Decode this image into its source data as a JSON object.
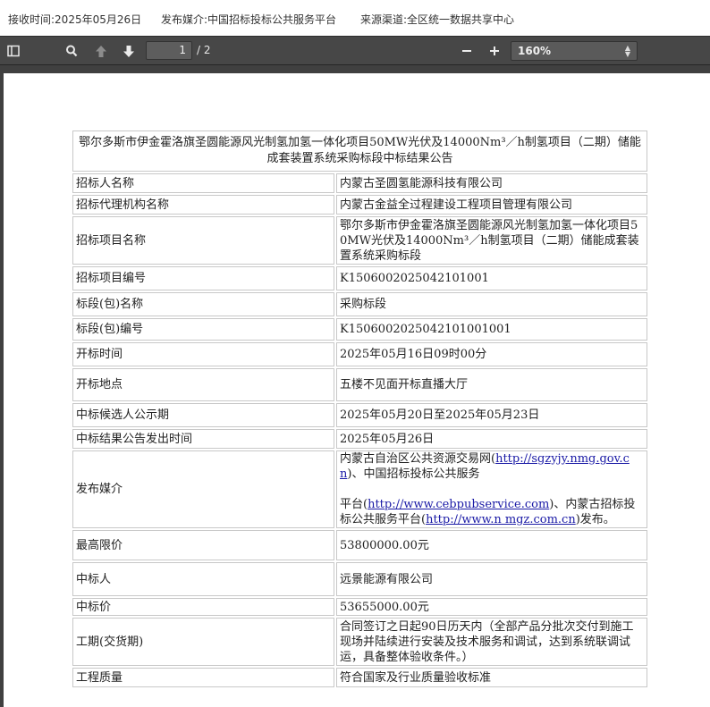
{
  "header": {
    "received": "接收时间:2025年05月26日",
    "media": "发布媒介:中国招标投标公共服务平台",
    "source": "来源渠道:全区统一数据共享中心"
  },
  "toolbar": {
    "page_current": "1",
    "page_total": "/ 2",
    "zoom": "160%",
    "icons": [
      "sidebar-toggle-icon",
      "search-icon",
      "page-up-icon",
      "page-down-icon",
      "zoom-out-icon",
      "zoom-in-icon"
    ]
  },
  "doc": {
    "title": "鄂尔多斯市伊金霍洛旗圣圆能源风光制氢加氢一体化项目50MW光伏及14000Nm³／h制氢项目（二期）储能成套装置系统采购标段中标结果公告",
    "rows": [
      {
        "label": "招标人名称",
        "value": "内蒙古圣圆氢能源科技有限公司"
      },
      {
        "label": "招标代理机构名称",
        "value": "内蒙古金益全过程建设工程项目管理有限公司"
      },
      {
        "label": "招标项目名称",
        "value": "鄂尔多斯市伊金霍洛旗圣圆能源风光制氢加氢一体化项目50MW光伏及14000Nm³／h制氢项目（二期）储能成套装置系统采购标段"
      },
      {
        "label": "招标项目编号",
        "value": "K1506002025042101001"
      },
      {
        "label": "标段(包)名称",
        "value": "采购标段"
      },
      {
        "label": "标段(包)编号",
        "value": "K1506002025042101001001"
      },
      {
        "label": "开标时间",
        "value": "2025年05月16日09时00分"
      },
      {
        "label": "开标地点",
        "value": "五楼不见面开标直播大厅"
      },
      {
        "label": "中标候选人公示期",
        "value": "2025年05月20日至2025年05月23日"
      },
      {
        "label": "中标结果公告发出时间",
        "value": "2025年05月26日"
      }
    ],
    "media_row": {
      "label": "发布媒介",
      "p1": "内蒙古自治区公共资源交易网(",
      "link1": "http://sgzyjy.nmg.gov.cn",
      "p2": ")、中国招标投标公共服务",
      "p3": "平台(",
      "link2": "http://www.cebpubservice.com",
      "p4": ")、内蒙古招标投标公共服务平台(",
      "link3": "http://www.n mgz.com.cn",
      "p5": ")发布。"
    },
    "rows2": [
      {
        "label": "最高限价",
        "value": "53800000.00元"
      },
      {
        "label": "中标人",
        "value": "远景能源有限公司"
      },
      {
        "label": "中标价",
        "value": "53655000.00元"
      },
      {
        "label": "工期(交货期)",
        "value": "合同签订之日起90日历天内（全部产品分批次交付到施工现场并陆续进行安装及技术服务和调试，达到系统联调试运，具备整体验收条件。）"
      },
      {
        "label": "工程质量",
        "value": "符合国家及行业质量验收标准"
      }
    ]
  }
}
